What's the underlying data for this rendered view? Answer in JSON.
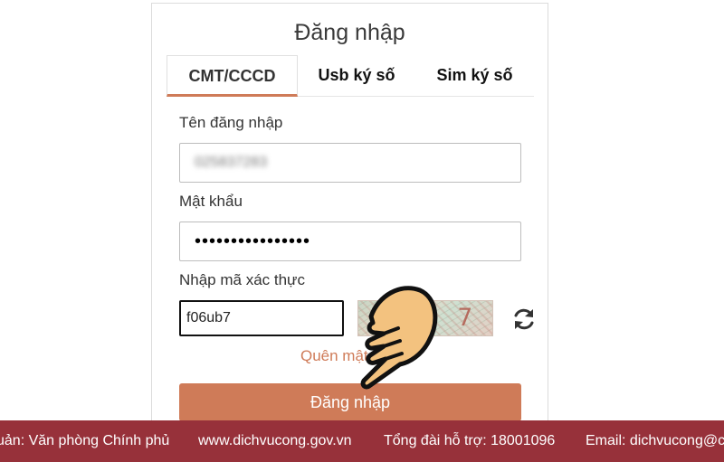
{
  "login": {
    "title": "Đăng nhập",
    "tabs": [
      {
        "label": "CMT/CCCD",
        "active": true
      },
      {
        "label": "Usb ký số",
        "active": false
      },
      {
        "label": "Sim ký số",
        "active": false
      }
    ],
    "username_label": "Tên đăng nhập",
    "username_value": "025837283",
    "password_label": "Mật khẩu",
    "password_value": "••••••••••••••••",
    "captcha_label": "Nhập mã xác thực",
    "captcha_value": "f06ub7",
    "captcha_image_text": "b 7",
    "forgot_label": "Quên mật",
    "submit_label": "Đăng nhập"
  },
  "footer": {
    "owner": "uản: Văn phòng Chính phủ",
    "website": "www.dichvucong.gov.vn",
    "hotline": "Tổng đài hỗ trợ: 18001096",
    "email": "Email: dichvucong@ch"
  },
  "colors": {
    "accent": "#cf7b58",
    "footer_bg": "#97313a"
  },
  "icons": [
    "refresh-icon",
    "pointing-hand-icon"
  ]
}
